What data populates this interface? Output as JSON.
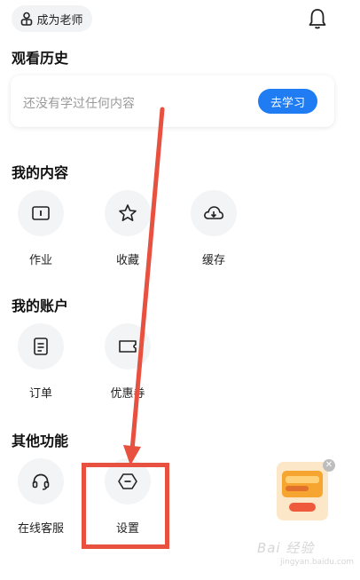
{
  "header": {
    "teacher_button_label": "成为老师",
    "bell_icon": "bell-icon",
    "teacher_icon": "user-icon"
  },
  "history": {
    "title": "观看历史",
    "empty_text": "还没有学过任何内容",
    "study_button_label": "去学习"
  },
  "my_content": {
    "title": "我的内容",
    "items": [
      {
        "label": "作业",
        "icon": "homework-icon"
      },
      {
        "label": "收藏",
        "icon": "star-icon"
      },
      {
        "label": "缓存",
        "icon": "cloud-download-icon"
      }
    ]
  },
  "my_account": {
    "title": "我的账户",
    "items": [
      {
        "label": "订单",
        "icon": "order-icon"
      },
      {
        "label": "优惠券",
        "icon": "coupon-icon"
      }
    ]
  },
  "other_functions": {
    "title": "其他功能",
    "items": [
      {
        "label": "在线客服",
        "icon": "headset-icon"
      },
      {
        "label": "设置",
        "icon": "settings-icon"
      }
    ]
  },
  "promo": {
    "icon": "promo-badge-icon",
    "close_icon": "close-icon"
  },
  "watermark": {
    "text": "Bai 经验",
    "sub": "jingyan.baidu.com"
  },
  "colors": {
    "accent": "#1f7cf2",
    "annotation": "#e8503f"
  }
}
